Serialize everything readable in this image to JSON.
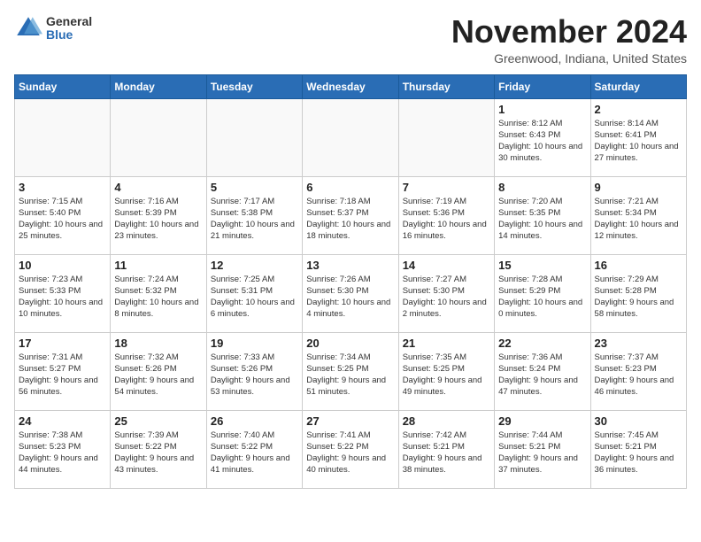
{
  "header": {
    "logo_general": "General",
    "logo_blue": "Blue",
    "month_title": "November 2024",
    "location": "Greenwood, Indiana, United States"
  },
  "days_of_week": [
    "Sunday",
    "Monday",
    "Tuesday",
    "Wednesday",
    "Thursday",
    "Friday",
    "Saturday"
  ],
  "weeks": [
    [
      {
        "day": "",
        "info": ""
      },
      {
        "day": "",
        "info": ""
      },
      {
        "day": "",
        "info": ""
      },
      {
        "day": "",
        "info": ""
      },
      {
        "day": "",
        "info": ""
      },
      {
        "day": "1",
        "info": "Sunrise: 8:12 AM\nSunset: 6:43 PM\nDaylight: 10 hours and 30 minutes."
      },
      {
        "day": "2",
        "info": "Sunrise: 8:14 AM\nSunset: 6:41 PM\nDaylight: 10 hours and 27 minutes."
      }
    ],
    [
      {
        "day": "3",
        "info": "Sunrise: 7:15 AM\nSunset: 5:40 PM\nDaylight: 10 hours and 25 minutes."
      },
      {
        "day": "4",
        "info": "Sunrise: 7:16 AM\nSunset: 5:39 PM\nDaylight: 10 hours and 23 minutes."
      },
      {
        "day": "5",
        "info": "Sunrise: 7:17 AM\nSunset: 5:38 PM\nDaylight: 10 hours and 21 minutes."
      },
      {
        "day": "6",
        "info": "Sunrise: 7:18 AM\nSunset: 5:37 PM\nDaylight: 10 hours and 18 minutes."
      },
      {
        "day": "7",
        "info": "Sunrise: 7:19 AM\nSunset: 5:36 PM\nDaylight: 10 hours and 16 minutes."
      },
      {
        "day": "8",
        "info": "Sunrise: 7:20 AM\nSunset: 5:35 PM\nDaylight: 10 hours and 14 minutes."
      },
      {
        "day": "9",
        "info": "Sunrise: 7:21 AM\nSunset: 5:34 PM\nDaylight: 10 hours and 12 minutes."
      }
    ],
    [
      {
        "day": "10",
        "info": "Sunrise: 7:23 AM\nSunset: 5:33 PM\nDaylight: 10 hours and 10 minutes."
      },
      {
        "day": "11",
        "info": "Sunrise: 7:24 AM\nSunset: 5:32 PM\nDaylight: 10 hours and 8 minutes."
      },
      {
        "day": "12",
        "info": "Sunrise: 7:25 AM\nSunset: 5:31 PM\nDaylight: 10 hours and 6 minutes."
      },
      {
        "day": "13",
        "info": "Sunrise: 7:26 AM\nSunset: 5:30 PM\nDaylight: 10 hours and 4 minutes."
      },
      {
        "day": "14",
        "info": "Sunrise: 7:27 AM\nSunset: 5:30 PM\nDaylight: 10 hours and 2 minutes."
      },
      {
        "day": "15",
        "info": "Sunrise: 7:28 AM\nSunset: 5:29 PM\nDaylight: 10 hours and 0 minutes."
      },
      {
        "day": "16",
        "info": "Sunrise: 7:29 AM\nSunset: 5:28 PM\nDaylight: 9 hours and 58 minutes."
      }
    ],
    [
      {
        "day": "17",
        "info": "Sunrise: 7:31 AM\nSunset: 5:27 PM\nDaylight: 9 hours and 56 minutes."
      },
      {
        "day": "18",
        "info": "Sunrise: 7:32 AM\nSunset: 5:26 PM\nDaylight: 9 hours and 54 minutes."
      },
      {
        "day": "19",
        "info": "Sunrise: 7:33 AM\nSunset: 5:26 PM\nDaylight: 9 hours and 53 minutes."
      },
      {
        "day": "20",
        "info": "Sunrise: 7:34 AM\nSunset: 5:25 PM\nDaylight: 9 hours and 51 minutes."
      },
      {
        "day": "21",
        "info": "Sunrise: 7:35 AM\nSunset: 5:25 PM\nDaylight: 9 hours and 49 minutes."
      },
      {
        "day": "22",
        "info": "Sunrise: 7:36 AM\nSunset: 5:24 PM\nDaylight: 9 hours and 47 minutes."
      },
      {
        "day": "23",
        "info": "Sunrise: 7:37 AM\nSunset: 5:23 PM\nDaylight: 9 hours and 46 minutes."
      }
    ],
    [
      {
        "day": "24",
        "info": "Sunrise: 7:38 AM\nSunset: 5:23 PM\nDaylight: 9 hours and 44 minutes."
      },
      {
        "day": "25",
        "info": "Sunrise: 7:39 AM\nSunset: 5:22 PM\nDaylight: 9 hours and 43 minutes."
      },
      {
        "day": "26",
        "info": "Sunrise: 7:40 AM\nSunset: 5:22 PM\nDaylight: 9 hours and 41 minutes."
      },
      {
        "day": "27",
        "info": "Sunrise: 7:41 AM\nSunset: 5:22 PM\nDaylight: 9 hours and 40 minutes."
      },
      {
        "day": "28",
        "info": "Sunrise: 7:42 AM\nSunset: 5:21 PM\nDaylight: 9 hours and 38 minutes."
      },
      {
        "day": "29",
        "info": "Sunrise: 7:44 AM\nSunset: 5:21 PM\nDaylight: 9 hours and 37 minutes."
      },
      {
        "day": "30",
        "info": "Sunrise: 7:45 AM\nSunset: 5:21 PM\nDaylight: 9 hours and 36 minutes."
      }
    ]
  ]
}
